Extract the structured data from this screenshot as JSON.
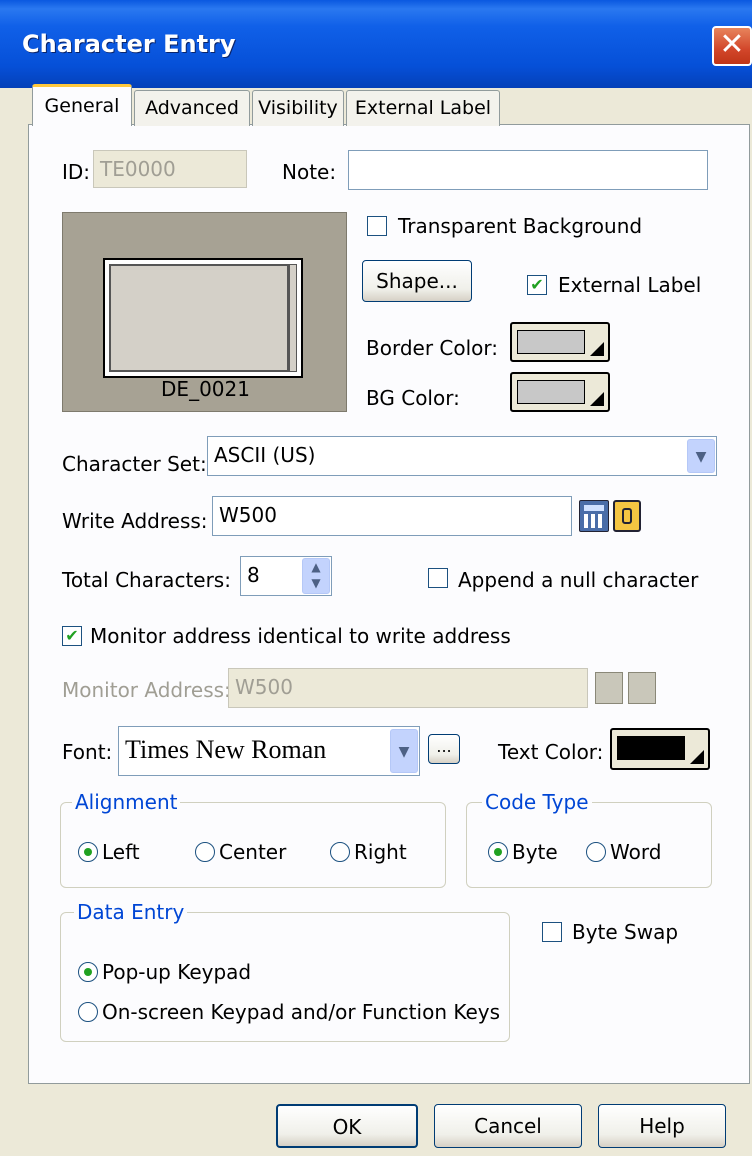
{
  "window": {
    "title": "Character Entry",
    "close_glyph": "✕"
  },
  "tabs": [
    "General",
    "Advanced",
    "Visibility",
    "External Label"
  ],
  "id_label": "ID:",
  "id_value": "TE0000",
  "note_label": "Note:",
  "note_value": "",
  "preview": {
    "caption": "DE_0021"
  },
  "transparent_bg": {
    "label": "Transparent Background",
    "checked": false
  },
  "shape_button": "Shape...",
  "external_label": {
    "label": "External Label",
    "checked": true
  },
  "border_color": {
    "label": "Border Color:",
    "color": "#c8c8c8"
  },
  "bg_color": {
    "label": "BG Color:",
    "color": "#c8c8c8"
  },
  "character_set": {
    "label": "Character Set:",
    "value": "ASCII (US)"
  },
  "write_address": {
    "label": "Write Address:",
    "value": "W500"
  },
  "total_characters": {
    "label": "Total Characters:",
    "value": "8"
  },
  "append_null": {
    "label": "Append a null character",
    "checked": false
  },
  "monitor_identical": {
    "label": "Monitor address identical to write address",
    "checked": true
  },
  "monitor_address": {
    "label": "Monitor Address:",
    "value": "W500"
  },
  "font": {
    "label": "Font:",
    "value": "Times New Roman",
    "more": "..."
  },
  "text_color": {
    "label": "Text Color:",
    "color": "#000000"
  },
  "alignment": {
    "title": "Alignment",
    "options": [
      "Left",
      "Center",
      "Right"
    ],
    "selected": "Left"
  },
  "code_type": {
    "title": "Code Type",
    "options": [
      "Byte",
      "Word"
    ],
    "selected": "Byte"
  },
  "data_entry": {
    "title": "Data Entry",
    "options": [
      "Pop-up Keypad",
      "On-screen Keypad and/or Function Keys"
    ],
    "selected": "Pop-up Keypad"
  },
  "byte_swap": {
    "label": "Byte Swap",
    "checked": false
  },
  "buttons": {
    "ok": "OK",
    "cancel": "Cancel",
    "help": "Help"
  },
  "colors": {
    "titlebar": "#0650d8",
    "group_title": "#0046d5",
    "check": "#21a121",
    "dialog_bg": "#ece9d8"
  }
}
